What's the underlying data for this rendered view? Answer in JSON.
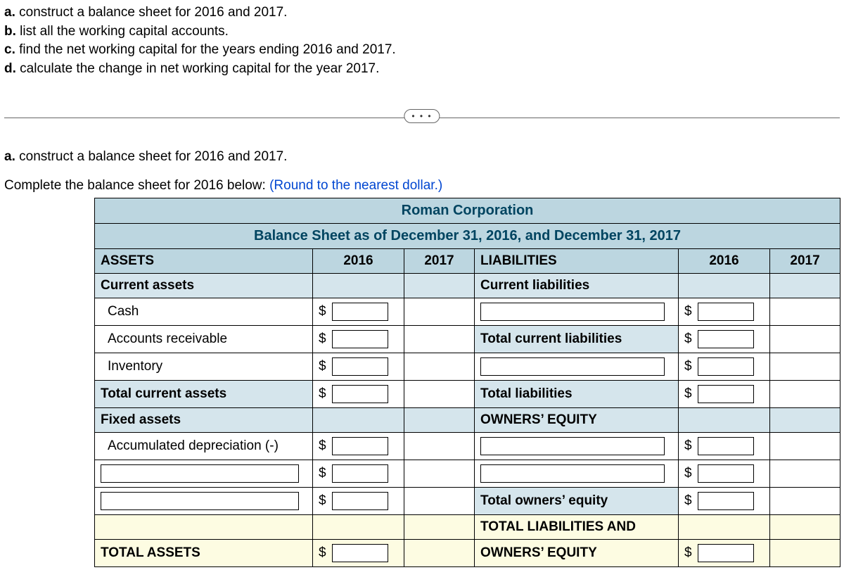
{
  "questions": {
    "a": {
      "letter": "a.",
      "text": " construct a balance sheet for 2016 and 2017."
    },
    "b": {
      "letter": "b.",
      "text": " list all the working capital accounts."
    },
    "c": {
      "letter": "c.",
      "text": " find the net working capital for the years ending 2016 and 2017."
    },
    "d": {
      "letter": "d.",
      "text": " calculate the change in net working capital for the year 2017."
    }
  },
  "ellipsis": "• • •",
  "section_a": {
    "letter": "a.",
    "text": " construct a balance sheet for 2016 and 2017."
  },
  "complete_pre": "Complete the balance sheet for 2016 below:  ",
  "complete_note": "(Round to the nearest dollar.)",
  "sheet": {
    "title1": "Roman Corporation",
    "title2": "Balance Sheet as of December 31, 2016, and December 31, 2017",
    "assets_head": "ASSETS",
    "y2016": "2016",
    "y2017": "2017",
    "liab_head": "LIABILITIES",
    "current_assets": "Current assets",
    "current_liab": "Current liabilities",
    "cash": "Cash",
    "ar": "Accounts receivable",
    "inv": "Inventory",
    "tca": "Total current assets",
    "tcl": "Total current liabilities",
    "tl": "Total liabilities",
    "fixed": "Fixed assets",
    "oe": "OWNERS’ EQUITY",
    "accdep": "Accumulated depreciation (-)",
    "toe": "Total owners’ equity",
    "tloe1": "TOTAL LIABILITIES AND",
    "tloe2": "OWNERS’ EQUITY",
    "ta": "TOTAL ASSETS",
    "dollar": "$"
  }
}
